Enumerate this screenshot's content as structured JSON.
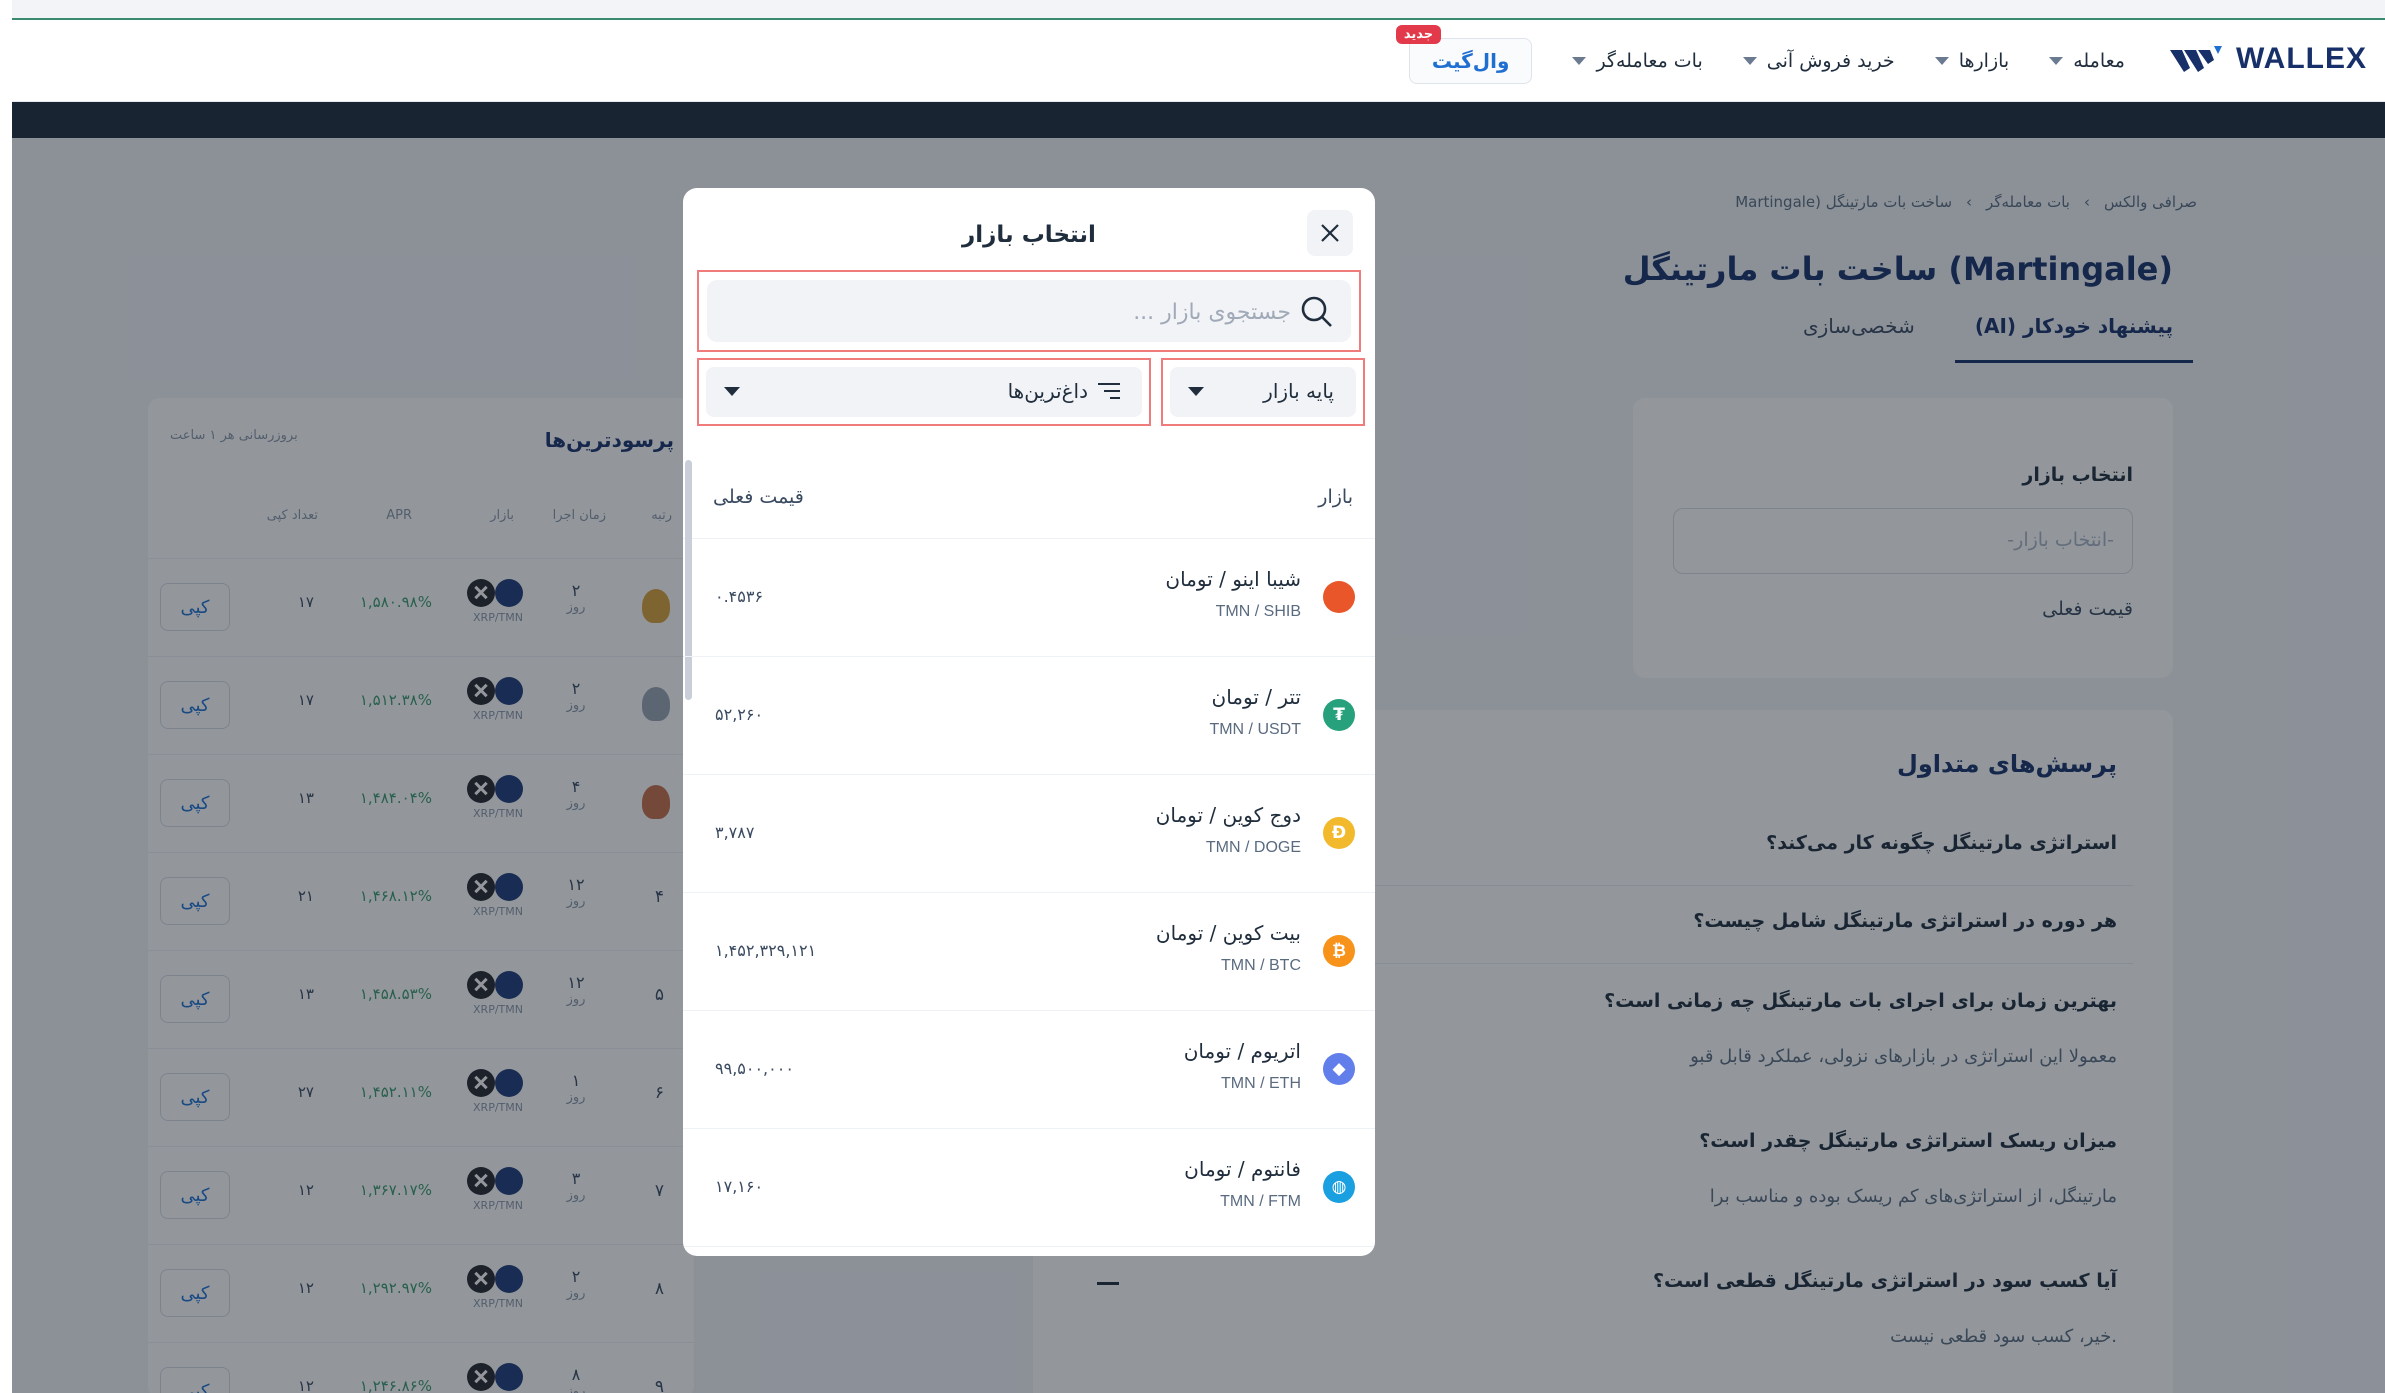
{
  "header": {
    "logo_text": "WALLEX",
    "nav": [
      {
        "label": "معامله"
      },
      {
        "label": "بازارها"
      },
      {
        "label": "خرید فروش آنی"
      },
      {
        "label": "بات معامله‌گر"
      }
    ],
    "wallgate_label": "وال‌گیت",
    "new_badge": "جدید"
  },
  "page": {
    "breadcrumb": [
      "صرافی والکس",
      "بات معامله‌گر",
      "ساخت بات مارتینگل (Martingale"
    ],
    "breadcrumb_sep": "›",
    "title": "ساخت بات مارتینگل (Martingale)",
    "tabs": [
      "پیشنهاد خودکار (AI)",
      "شخصی‌سازی"
    ],
    "market_field_label": "انتخاب بازار",
    "market_field_placeholder": "-انتخاب بازار-",
    "current_price_label": "قیمت فعلی"
  },
  "faq": {
    "title": "پرسش‌های متداول",
    "items": [
      {
        "q": "استراتژی مارتینگل چگونه کار می‌کند؟"
      },
      {
        "q": "هر دوره در استراتژی مارتینگل شامل چیست؟"
      },
      {
        "q": "بهترین زمان برای اجرای بات مارتینگل چه زمانی است؟",
        "a": "معمولا این استراتژی در بازارهای نزولی، عملکرد قابل قبو"
      },
      {
        "q": "میزان ریسک استراتژی مارتینگل چقدر است؟",
        "a": "مارتینگل، از استراتژی‌های کم ریسک بوده و مناسب برا"
      },
      {
        "q": "آیا کسب سود در استراتژی مارتینگل قطعی است؟",
        "a": "خیر، کسب سود قطعی نیست."
      }
    ]
  },
  "leaderboard": {
    "title": "پرسودترین‌ها",
    "update_note": "بروزرسانی هر ۱ ساعت",
    "headers": {
      "rank": "رتبه",
      "runtime": "زمان اجرا",
      "market": "بازار",
      "apr": "APR",
      "copies": "تعداد کپی"
    },
    "day_unit": "روز",
    "copy_label": "کپی",
    "rows": [
      {
        "rank": "۱",
        "medal": "#d9a23a",
        "time": "۲",
        "pair": "XRP/TMN",
        "apr": "۱,۵۸۰.۹۸%",
        "copies": "۱۷"
      },
      {
        "rank": "۲",
        "medal": "#9aa4b4",
        "time": "۲",
        "pair": "XRP/TMN",
        "apr": "۱,۵۱۲.۳۸%",
        "copies": "۱۷"
      },
      {
        "rank": "۳",
        "medal": "#c8704a",
        "time": "۴",
        "pair": "XRP/TMN",
        "apr": "۱,۴۸۴.۰۴%",
        "copies": "۱۳"
      },
      {
        "rank": "۴",
        "medal": "",
        "time": "۱۲",
        "pair": "XRP/TMN",
        "apr": "۱,۴۶۸.۱۲%",
        "copies": "۲۱"
      },
      {
        "rank": "۵",
        "medal": "",
        "time": "۱۲",
        "pair": "XRP/TMN",
        "apr": "۱,۴۵۸.۵۳%",
        "copies": "۱۳"
      },
      {
        "rank": "۶",
        "medal": "",
        "time": "۱",
        "pair": "XRP/TMN",
        "apr": "۱,۴۵۲.۱۱%",
        "copies": "۲۷"
      },
      {
        "rank": "۷",
        "medal": "",
        "time": "۳",
        "pair": "XRP/TMN",
        "apr": "۱,۳۶۷.۱۷%",
        "copies": "۱۲"
      },
      {
        "rank": "۸",
        "medal": "",
        "time": "۲",
        "pair": "XRP/TMN",
        "apr": "۱,۲۹۲.۹۷%",
        "copies": "۱۲"
      },
      {
        "rank": "۹",
        "medal": "",
        "time": "۸",
        "pair": "",
        "apr": "۱,۲۴۶.۸۶%",
        "copies": "۱۲"
      }
    ]
  },
  "modal": {
    "title": "انتخاب بازار",
    "search_placeholder": "جستجوی بازار ...",
    "base_filter": "پایه بازار",
    "sort_filter": "داغ‌ترین‌ها",
    "col_market": "بازار",
    "col_price": "قیمت فعلی",
    "markets": [
      {
        "name": "شیبا اینو / تومان",
        "pair": "TMN / SHIB",
        "price": "۰.۴۵۳۶",
        "icon": "shib-icon",
        "color": "#e8562a",
        "glyph": ""
      },
      {
        "name": "تتر / تومان",
        "pair": "TMN / USDT",
        "price": "۵۲,۲۶۰",
        "icon": "tether-icon",
        "color": "#26a17b",
        "glyph": "₮"
      },
      {
        "name": "دوج کوین / تومان",
        "pair": "TMN / DOGE",
        "price": "۳,۷۸۷",
        "icon": "doge-icon",
        "color": "#f2b92d",
        "glyph": "Ð"
      },
      {
        "name": "بیت کوین / تومان",
        "pair": "TMN / BTC",
        "price": "۱,۴۵۲,۳۲۹,۱۲۱",
        "icon": "bitcoin-icon",
        "color": "#f7931a",
        "glyph": "₿"
      },
      {
        "name": "اتریوم / تومان",
        "pair": "TMN / ETH",
        "price": "۹۹,۵۰۰,۰۰۰",
        "icon": "ethereum-icon",
        "color": "#627eea",
        "glyph": "◆"
      },
      {
        "name": "فانتوم / تومان",
        "pair": "TMN / FTM",
        "price": "۱۷,۱۶۰",
        "icon": "fantom-icon",
        "color": "#1a9fe0",
        "glyph": "◍"
      }
    ]
  }
}
